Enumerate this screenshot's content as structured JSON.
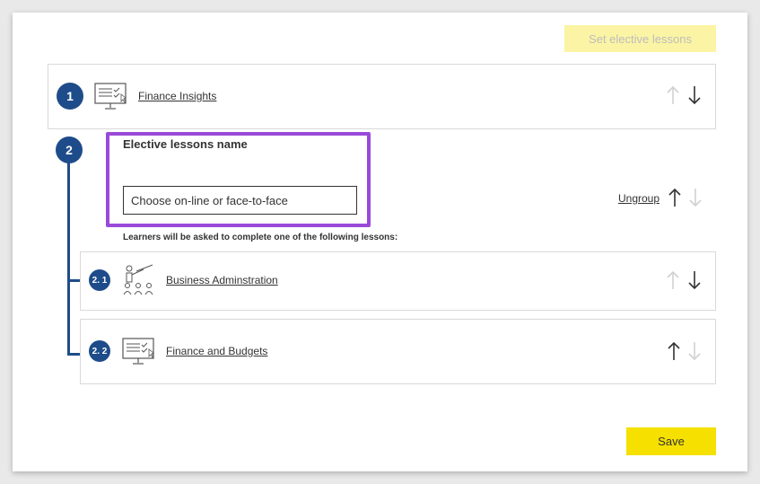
{
  "toolbar": {
    "set_elective_label": "Set elective lessons"
  },
  "lessons": [
    {
      "number": "1",
      "title": "Finance Insights",
      "icon": "computer-screen-icon"
    }
  ],
  "group": {
    "number": "2",
    "name_label": "Elective lessons name",
    "name_value": "Choose on-line or face-to-face",
    "ungroup_label": "Ungroup",
    "instruction": "Learners will be asked to complete one of the following lessons:",
    "items": [
      {
        "number": "2. 1",
        "title": "Business Adminstration",
        "icon": "presenter-audience-icon"
      },
      {
        "number": "2. 2",
        "title": "Finance and Budgets",
        "icon": "computer-screen-icon"
      }
    ]
  },
  "footer": {
    "save_label": "Save"
  },
  "colors": {
    "accent_blue": "#1e4c8a",
    "save_yellow": "#f5e000",
    "disabled_yellow": "#fbf4a4",
    "highlight_purple": "#9a4ad9"
  }
}
